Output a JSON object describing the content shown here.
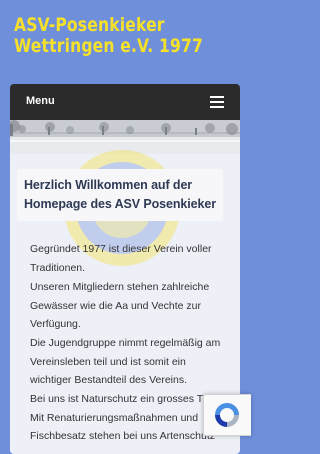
{
  "site": {
    "title_line1": "ASV-Posenkieker",
    "title_line2": "Wettringen e.V. 1977"
  },
  "nav": {
    "menu_label": "Menu",
    "toggle_icon": "hamburger-icon"
  },
  "content": {
    "heading": "Herzlich Willkommen auf der Homepage des ASV Posenkieker",
    "paragraphs": [
      "Gegründet 1977 ist dieser Verein voller Traditionen.",
      "Unseren Mitgliedern stehen zahlreiche Gewässer wie die Aa und Vechte zur Verfügung.",
      "Die Jugendgruppe nimmt regelmäßig am Vereinsleben teil und ist somit ein wichtiger Bestandteil des Vereins.",
      "Bei uns ist Naturschutz ein grosses The Mit Renaturierungsmaßnahmen und Fischbesatz stehen bei uns Artenschutz"
    ]
  },
  "widgets": {
    "recaptcha_icon": "recaptcha-icon"
  },
  "colors": {
    "background": "#6f8fdb",
    "title": "#f5e12a",
    "navbar": "#2b2b2b",
    "card": "#eef0f8",
    "heading_text": "#2f3a55"
  }
}
